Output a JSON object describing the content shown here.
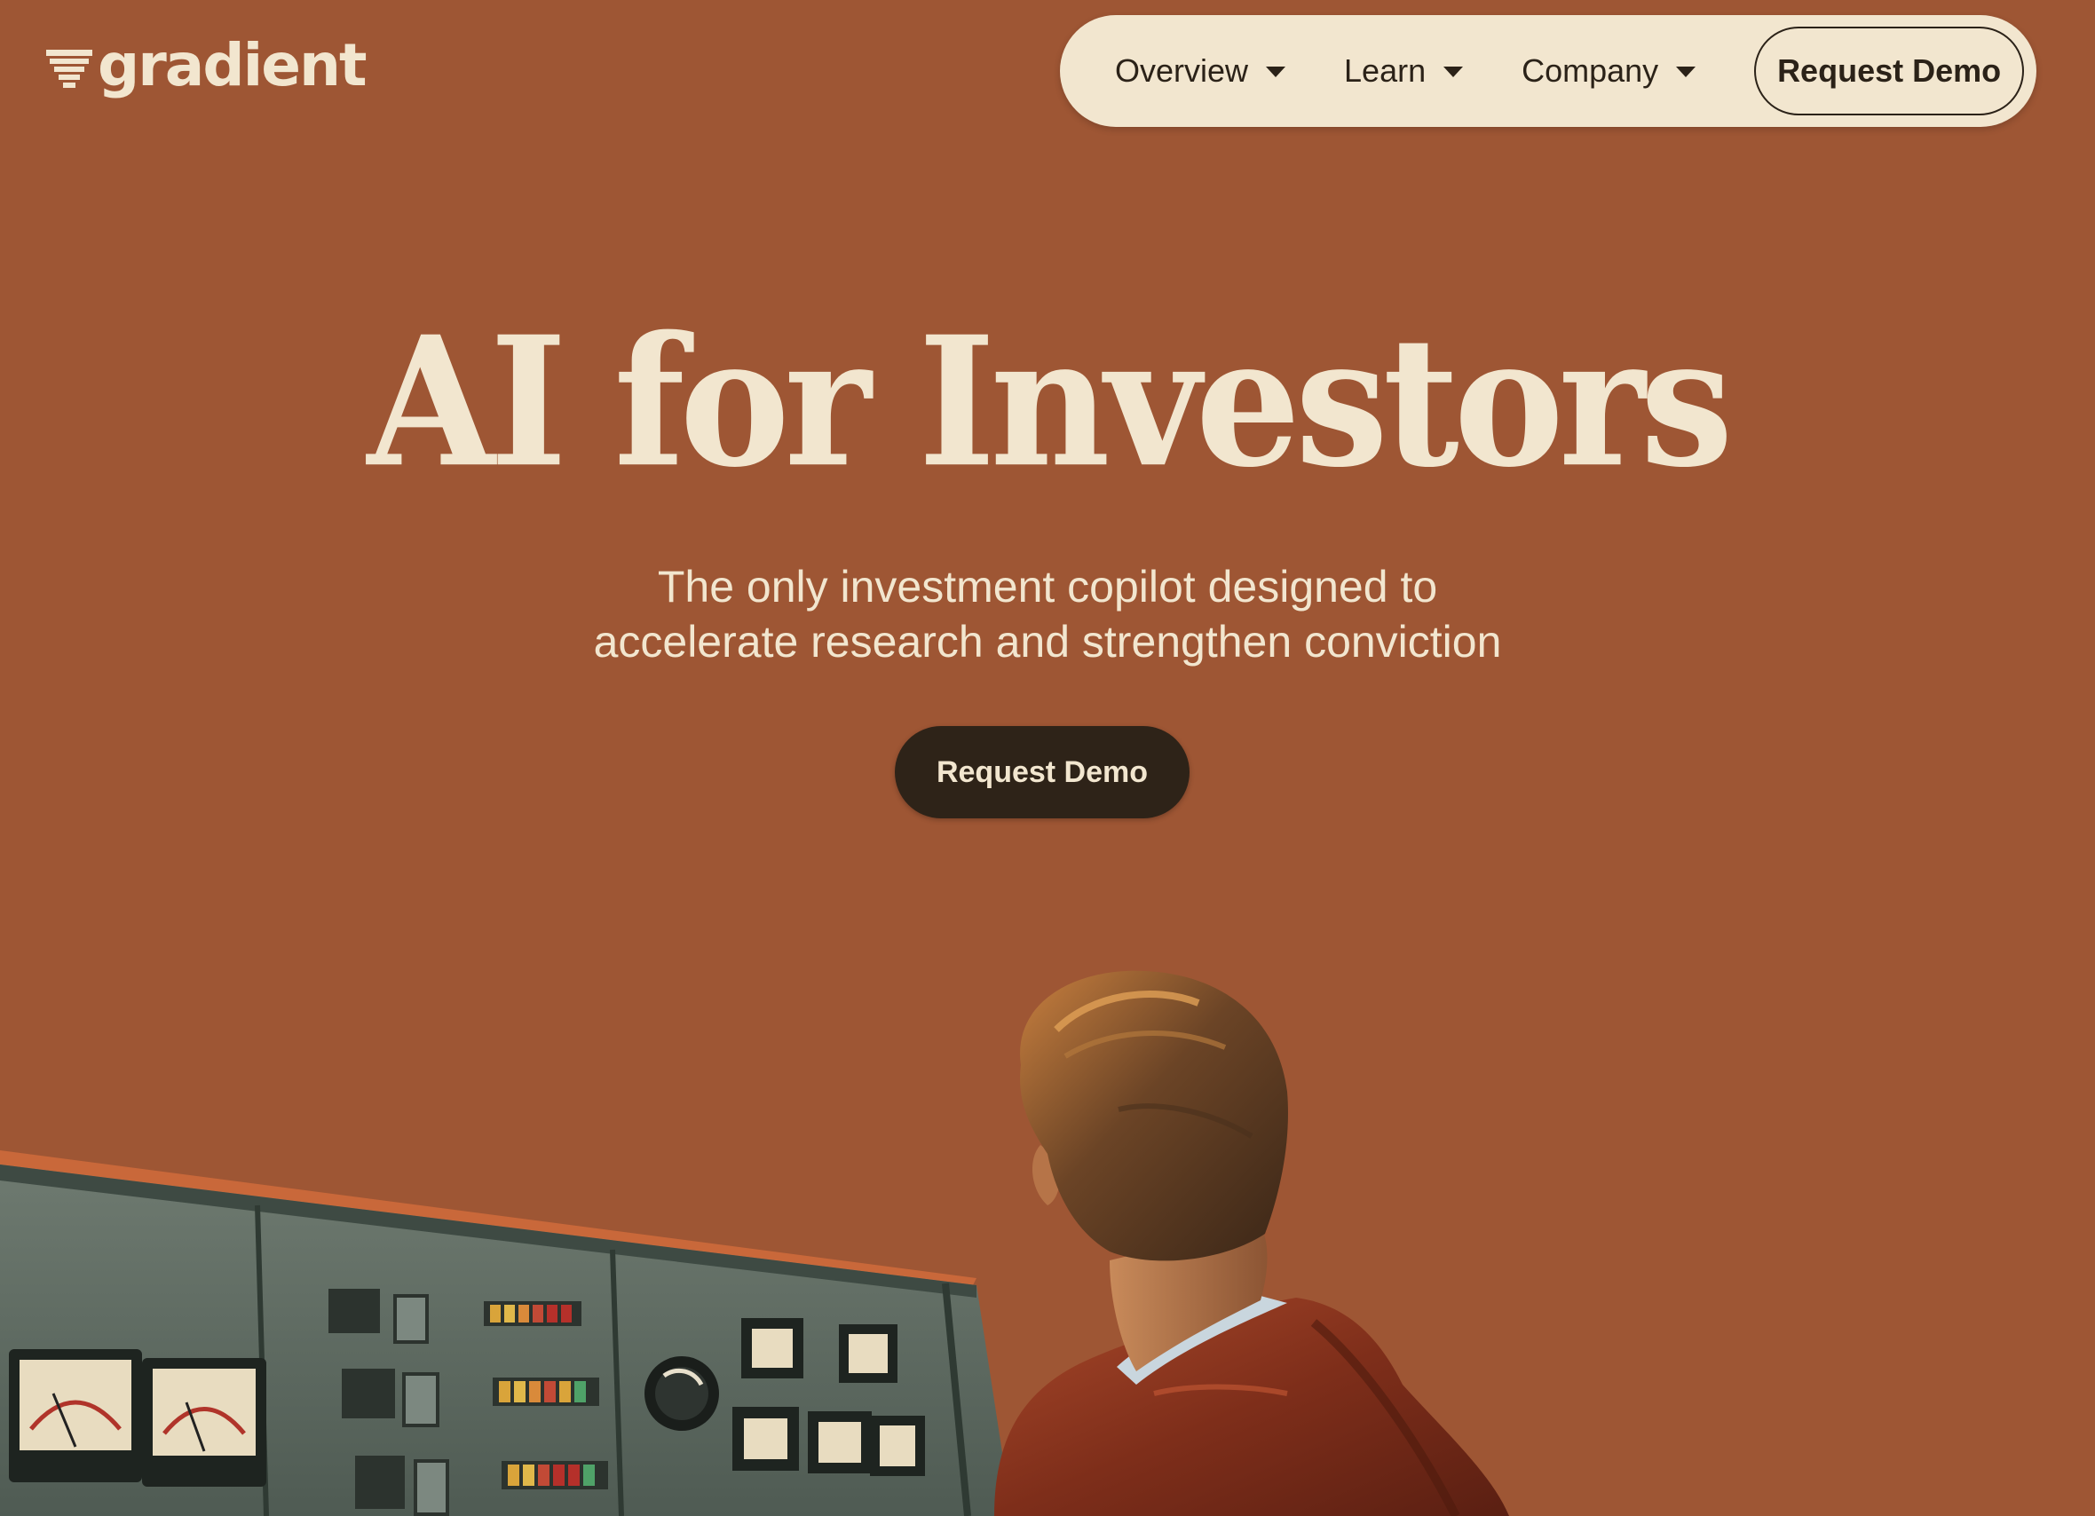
{
  "brand": {
    "name": "gradient",
    "logo_icon": "gradient-logo-mark",
    "background_color": "#9E5634",
    "cream_color": "#F2E6CF",
    "dark_color": "#2E2318"
  },
  "nav": {
    "items": [
      {
        "label": "Overview",
        "icon": "chevron-down-icon"
      },
      {
        "label": "Learn",
        "icon": "chevron-down-icon"
      },
      {
        "label": "Company",
        "icon": "chevron-down-icon"
      }
    ],
    "cta_label": "Request Demo"
  },
  "hero": {
    "title": "AI for Investors",
    "subtitle_line1": "The only investment copilot designed to",
    "subtitle_line2": "accelerate research and strengthen conviction",
    "cta_label": "Request Demo"
  },
  "illustration": {
    "subject": "retro-console-operator-illustration"
  }
}
